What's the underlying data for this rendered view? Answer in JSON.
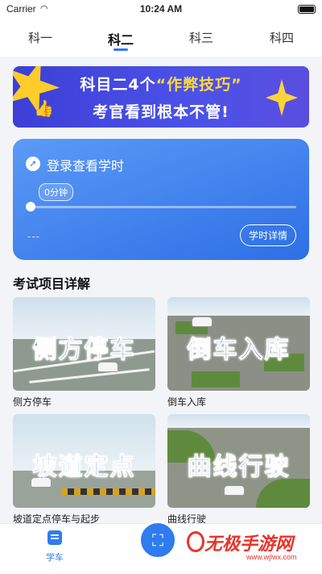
{
  "status_bar": {
    "carrier": "Carrier",
    "time": "10:24 AM"
  },
  "tabs": [
    {
      "label": "科一"
    },
    {
      "label": "科二",
      "active": true
    },
    {
      "label": "科三"
    },
    {
      "label": "科四"
    }
  ],
  "promo_banner": {
    "line1_prefix": "科目二4个",
    "line1_highlight": "“作弊技巧”",
    "line2": "考官看到根本不管!"
  },
  "study_card": {
    "login_text": "登录查看学时",
    "minutes": "0分钟",
    "progress": 0,
    "placeholder": "---",
    "detail_button": "学时详情"
  },
  "section": {
    "title": "考试项目详解"
  },
  "exam_items": [
    {
      "overlay": "侧方停车",
      "label": "侧方停车"
    },
    {
      "overlay": "倒车入库",
      "label": "倒车入库"
    },
    {
      "overlay": "坡道定点",
      "label": "坡道定点停车与起步"
    },
    {
      "overlay": "曲线行驶",
      "label": "曲线行驶"
    }
  ],
  "bottom_nav": {
    "xueche_label": "学车"
  },
  "watermark": {
    "main": "无极手游网",
    "sub": "www.wjlwx.com"
  },
  "colors": {
    "accent": "#2f7bf0",
    "banner_bg": "#4b52e8",
    "highlight": "#ffd93a",
    "watermark": "#e8332a"
  }
}
